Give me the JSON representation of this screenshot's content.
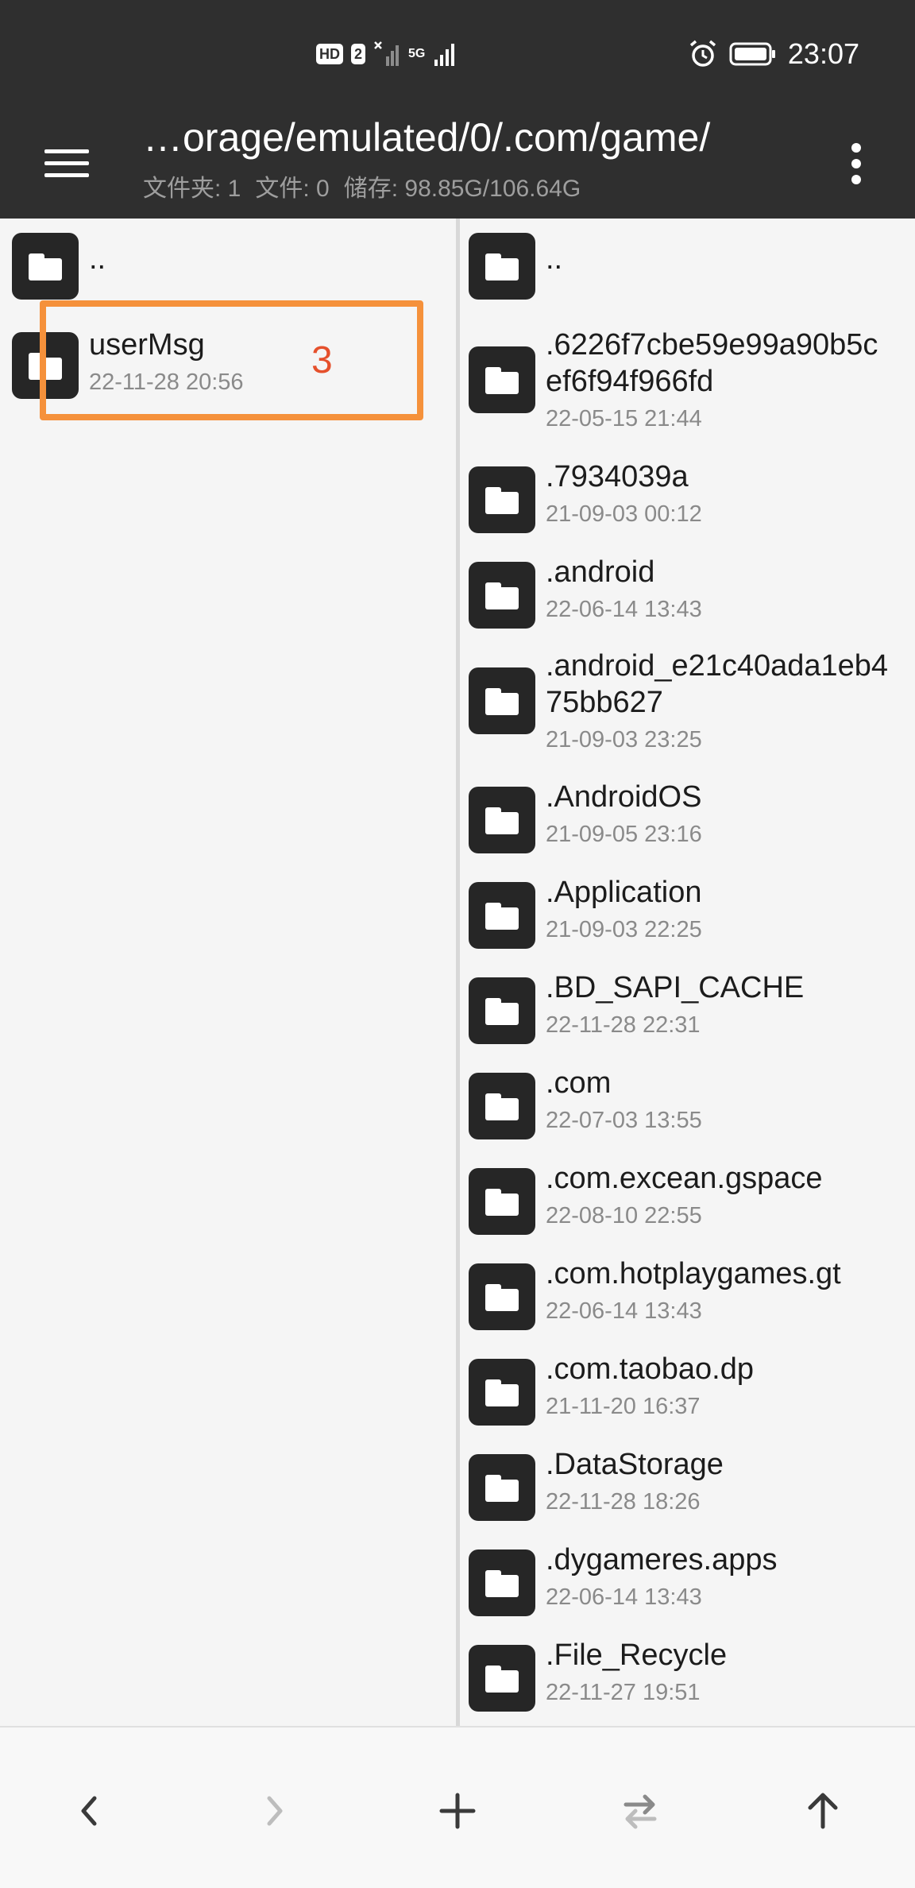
{
  "status_bar": {
    "badge_hd": "HD",
    "badge_sim": "2",
    "net_5g": "5G",
    "time": "23:07"
  },
  "app_bar": {
    "path": "…orage/emulated/0/.com/game/",
    "folders": "文件夹: 1",
    "files": "文件: 0",
    "storage": "储存: 98.85G/106.64G"
  },
  "left_pane": {
    "items": [
      {
        "name": "..",
        "date": ""
      },
      {
        "name": "userMsg",
        "date": "22-11-28 20:56"
      }
    ],
    "annotation": "3"
  },
  "right_pane": {
    "items": [
      {
        "name": "..",
        "date": ""
      },
      {
        "name": ".6226f7cbe59e99a90b5c",
        "name2": "ef6f94f966fd",
        "date": "22-05-15 21:44"
      },
      {
        "name": ".7934039a",
        "date": "21-09-03 00:12"
      },
      {
        "name": ".android",
        "date": "22-06-14 13:43"
      },
      {
        "name": ".android_e21c40ada1eb4",
        "name2": "75bb627",
        "date": "21-09-03 23:25"
      },
      {
        "name": ".AndroidOS",
        "date": "21-09-05 23:16"
      },
      {
        "name": ".Application",
        "date": "21-09-03 22:25"
      },
      {
        "name": ".BD_SAPI_CACHE",
        "date": "22-11-28 22:31"
      },
      {
        "name": ".com",
        "date": "22-07-03 13:55"
      },
      {
        "name": ".com.excean.gspace",
        "date": "22-08-10 22:55"
      },
      {
        "name": ".com.hotplaygames.gt",
        "date": "22-06-14 13:43"
      },
      {
        "name": ".com.taobao.dp",
        "date": "21-11-20 16:37"
      },
      {
        "name": ".DataStorage",
        "date": "22-11-28 18:26"
      },
      {
        "name": ".dygameres.apps",
        "date": "22-06-14 13:43"
      },
      {
        "name": ".File_Recycle",
        "date": "22-11-27 19:51"
      }
    ]
  },
  "icons": {
    "menu": "hamburger-menu-icon",
    "more": "more-vertical-icon",
    "folder": "folder-icon",
    "back": "chevron-left-icon",
    "forward": "chevron-right-icon",
    "add": "plus-icon",
    "swap": "swap-icon",
    "up": "arrow-up-icon"
  },
  "colors": {
    "bar_bg": "#2f2f2f",
    "highlight": "#f5913b",
    "annotation": "#e5502c"
  }
}
